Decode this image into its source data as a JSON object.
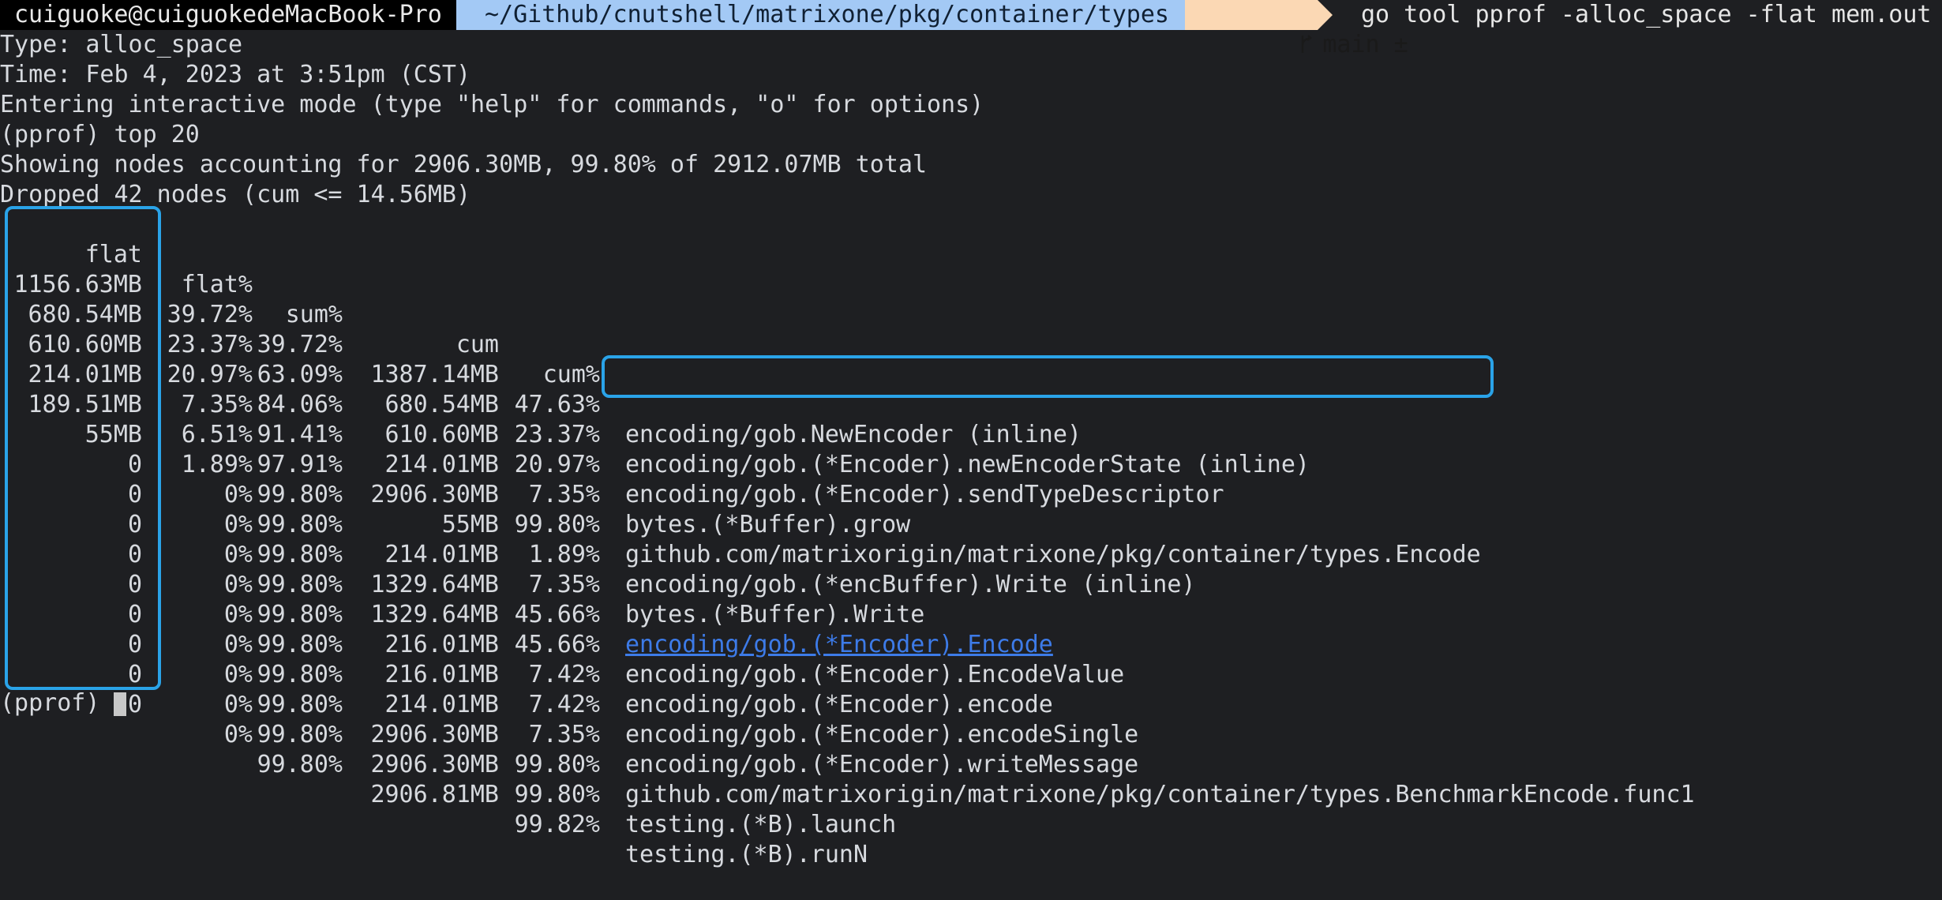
{
  "prompt": {
    "user_host": "cuiguoke@cuiguokedeMacBook-Pro",
    "path": "~/Github/cnutshell/matrixone/pkg/container/types",
    "branch": "main ±",
    "command": "go tool pprof -alloc_space -flat mem.out",
    "colors": {
      "user_bg": "#000000",
      "path_bg": "#a3c9f5",
      "git_bg": "#fbd8b4"
    },
    "branch_icon": "git-branch-icon"
  },
  "header_lines": [
    "Type: alloc_space",
    "Time: Feb 4, 2023 at 3:51pm (CST)",
    "Entering interactive mode (type \"help\" for commands, \"o\" for options)",
    "(pprof) top 20",
    "Showing nodes accounting for 2906.30MB, 99.80% of 2912.07MB total",
    "Dropped 42 nodes (cum <= 14.56MB)"
  ],
  "table": {
    "columns": [
      "flat",
      "flat%",
      "sum%",
      "cum",
      "cum%"
    ],
    "rows": [
      {
        "flat": "1156.63MB",
        "flatp": "39.72%",
        "sum": "39.72%",
        "cum": "1387.14MB",
        "cump": "47.63%",
        "name": "encoding/gob.NewEncoder (inline)"
      },
      {
        "flat": "680.54MB",
        "flatp": "23.37%",
        "sum": "63.09%",
        "cum": "680.54MB",
        "cump": "23.37%",
        "name": "encoding/gob.(*Encoder).newEncoderState (inline)"
      },
      {
        "flat": "610.60MB",
        "flatp": "20.97%",
        "sum": "84.06%",
        "cum": "610.60MB",
        "cump": "20.97%",
        "name": "encoding/gob.(*Encoder).sendTypeDescriptor"
      },
      {
        "flat": "214.01MB",
        "flatp": "7.35%",
        "sum": "91.41%",
        "cum": "214.01MB",
        "cump": "7.35%",
        "name": "bytes.(*Buffer).grow"
      },
      {
        "flat": "189.51MB",
        "flatp": "6.51%",
        "sum": "97.91%",
        "cum": "2906.30MB",
        "cump": "99.80%",
        "name": "github.com/matrixorigin/matrixone/pkg/container/types.Encode"
      },
      {
        "flat": "55MB",
        "flatp": "1.89%",
        "sum": "99.80%",
        "cum": "55MB",
        "cump": "1.89%",
        "name": "encoding/gob.(*encBuffer).Write (inline)"
      },
      {
        "flat": "0",
        "flatp": "0%",
        "sum": "99.80%",
        "cum": "214.01MB",
        "cump": "7.35%",
        "name": "bytes.(*Buffer).Write"
      },
      {
        "flat": "0",
        "flatp": "0%",
        "sum": "99.80%",
        "cum": "1329.64MB",
        "cump": "45.66%",
        "name": "encoding/gob.(*Encoder).Encode"
      },
      {
        "flat": "0",
        "flatp": "0%",
        "sum": "99.80%",
        "cum": "1329.64MB",
        "cump": "45.66%",
        "name": "encoding/gob.(*Encoder).EncodeValue"
      },
      {
        "flat": "0",
        "flatp": "0%",
        "sum": "99.80%",
        "cum": "216.01MB",
        "cump": "7.42%",
        "name": "encoding/gob.(*Encoder).encode"
      },
      {
        "flat": "0",
        "flatp": "0%",
        "sum": "99.80%",
        "cum": "216.01MB",
        "cump": "7.42%",
        "name": "encoding/gob.(*Encoder).encodeSingle"
      },
      {
        "flat": "0",
        "flatp": "0%",
        "sum": "99.80%",
        "cum": "214.01MB",
        "cump": "7.35%",
        "name": "encoding/gob.(*Encoder).writeMessage"
      },
      {
        "flat": "0",
        "flatp": "0%",
        "sum": "99.80%",
        "cum": "2906.30MB",
        "cump": "99.80%",
        "name": "github.com/matrixorigin/matrixone/pkg/container/types.BenchmarkEncode.func1"
      },
      {
        "flat": "0",
        "flatp": "0%",
        "sum": "99.80%",
        "cum": "2906.30MB",
        "cump": "99.80%",
        "name": "testing.(*B).launch"
      },
      {
        "flat": "0",
        "flatp": "0%",
        "sum": "99.80%",
        "cum": "2906.81MB",
        "cump": "99.82%",
        "name": "testing.(*B).runN"
      }
    ]
  },
  "final_prompt": "(pprof)",
  "highlight_color": "#2aa3e8",
  "link_color": "#3d7be8"
}
